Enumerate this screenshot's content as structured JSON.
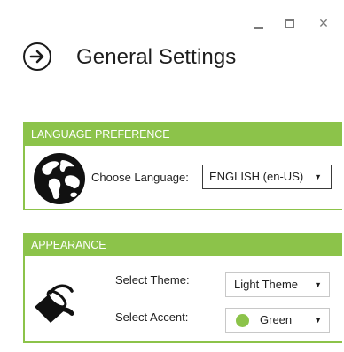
{
  "window": {
    "controls": {
      "minimize_icon": "minimize-icon",
      "maximize_icon": "maximize-icon",
      "close_icon": "close-icon",
      "close_glyph": "✕"
    }
  },
  "header": {
    "back_icon": "arrow-right-circle-icon",
    "title": "General Settings"
  },
  "language_section": {
    "header": "LANGUAGE PREFERENCE",
    "icon": "globe-icon",
    "choose_label": "Choose Language:",
    "selected_language": "ENGLISH (en-US)",
    "caret": "▼"
  },
  "appearance_section": {
    "header": "APPEARANCE",
    "icon": "paint-bucket-icon",
    "theme_label": "Select Theme:",
    "selected_theme": "Light Theme",
    "accent_label": "Select Accent:",
    "selected_accent": "Green",
    "caret": "▼"
  },
  "colors": {
    "accent": "#8cc34a",
    "text": "#1e1e1e",
    "border": "#c8c8c8"
  }
}
